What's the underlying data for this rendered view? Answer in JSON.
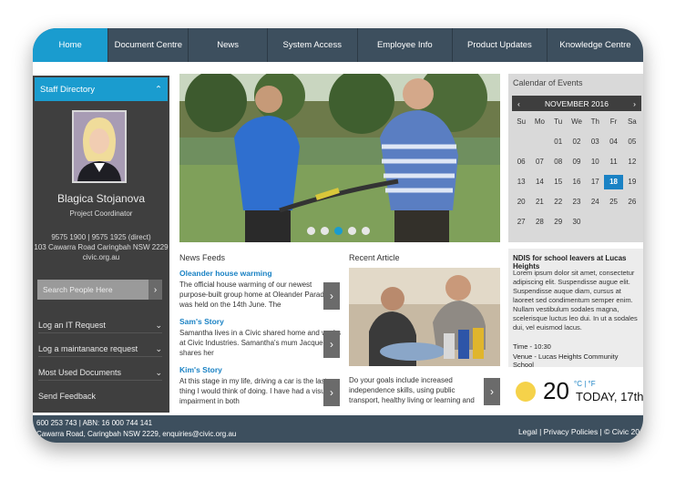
{
  "nav": {
    "items": [
      {
        "label": "Home"
      },
      {
        "label": "Document Centre"
      },
      {
        "label": "News"
      },
      {
        "label": "System Access"
      },
      {
        "label": "Employee Info"
      },
      {
        "label": "Product Updates"
      },
      {
        "label": "Knowledge Centre"
      }
    ]
  },
  "sidebar": {
    "header": "Staff Directory",
    "staff": {
      "name": "Blagica Stojanova",
      "role": "Project Coordinator",
      "phones": "9575 1900  |  9575 1925 (direct)",
      "address": "103 Cawarra Road Caringbah NSW 2229",
      "web": "civic.org.au"
    },
    "search_placeholder": "Search People Here",
    "links": [
      {
        "label": "Log an IT Request"
      },
      {
        "label": "Log a maintanance request"
      },
      {
        "label": "Most Used Documents"
      },
      {
        "label": "Send Feedback"
      }
    ]
  },
  "news": {
    "title": "News Feeds",
    "items": [
      {
        "title": "Oleander house warming",
        "body": "The official house warming of our newest purpose-built group home at Oleander Parade was held on the 14th June. The"
      },
      {
        "title": "Sam's Story",
        "body": "Samantha lives in a Civic shared home and works at Civic Industries. Samantha's mum Jacqueline shares her"
      },
      {
        "title": "Kim's Story",
        "body": "At this stage in my life, driving a car is the last thing I would think of doing. I have had a visual impairment in both"
      }
    ]
  },
  "recent": {
    "title": "Recent Article",
    "body": "Do your goals include increased independence skills, using public transport, healthy living or learning and"
  },
  "calendar": {
    "title": "Calendar of Events",
    "month": "NOVEMBER 2016",
    "days": [
      "Su",
      "Mo",
      "Tu",
      "We",
      "Th",
      "Fr",
      "Sa"
    ],
    "dates": [
      "",
      "",
      "01",
      "02",
      "03",
      "04",
      "05",
      "06",
      "07",
      "08",
      "09",
      "10",
      "11",
      "12",
      "13",
      "14",
      "15",
      "16",
      "17",
      "18",
      "19",
      "20",
      "21",
      "22",
      "23",
      "24",
      "25",
      "26",
      "27",
      "28",
      "29",
      "30",
      "",
      "",
      ""
    ],
    "today": "18"
  },
  "event": {
    "title": "NDIS for school leavers at Lucas Heights",
    "body": "Lorem ipsum dolor sit amet, consectetur adipiscing elit. Suspendisse augue elit. Suspendisse auque diam, cursus at laoreet sed condimentum semper enim. Nullam vestibulum sodales magna, scelerisque luctus leo dui. In ut a sodales dui, vel euismod lacus.",
    "time": "Time - 10:30",
    "venue": "Venue - Lucas Heights Community School"
  },
  "weather": {
    "temp": "20",
    "unit": "°C | °F",
    "label": "TODAY, 17th"
  },
  "footer": {
    "line1": "600 253 743  |  ABN: 16 000 744 141",
    "line2": "Cawarra Road, Caringbah NSW 2229, enquiries@civic.org.au",
    "right": "Legal  |  Privacy Policies  |  © Civic 20"
  },
  "colors": {
    "accent": "#1a9ccf",
    "nav": "#3d4f5e",
    "sidebar": "#3f3f3f",
    "today": "#1a82c4"
  }
}
